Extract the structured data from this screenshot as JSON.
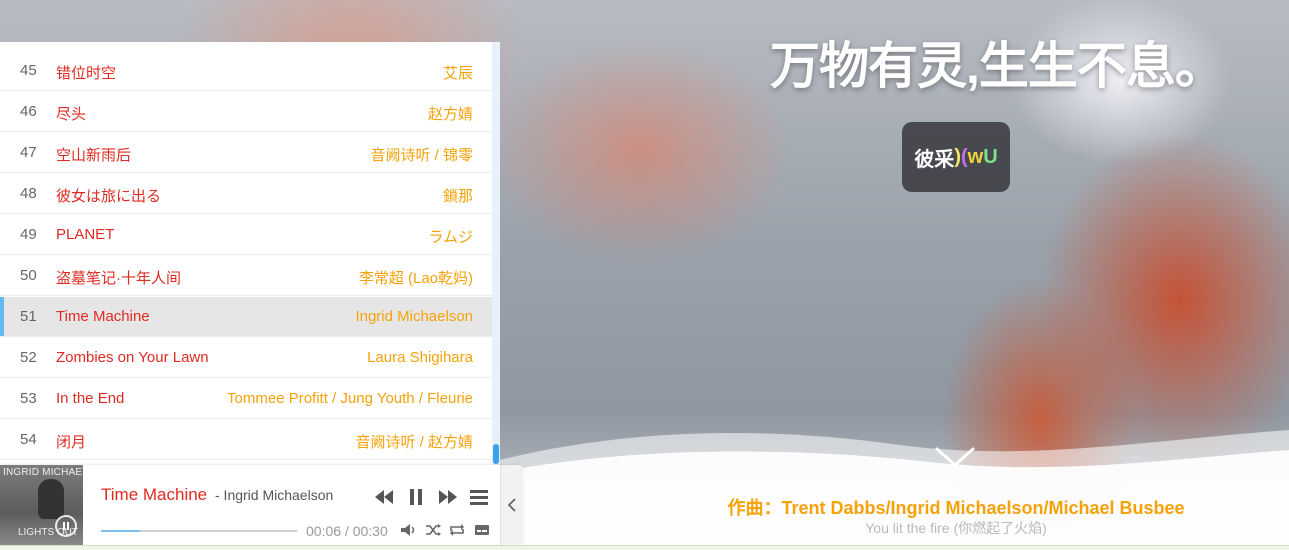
{
  "headline": "万物有灵,生生不息。",
  "badge": {
    "part0": "彼采",
    "part1": ")",
    "part2": "(",
    "part3": "w",
    "part4": "U"
  },
  "lyrics": {
    "credit": "作曲：Trent Dabbs/Ingrid Michaelson/Michael Busbee",
    "line": "You lit the fire (你燃起了火焰)"
  },
  "playlist": {
    "rows": [
      {
        "num": "45",
        "title": "错位时空",
        "artist": "艾辰"
      },
      {
        "num": "46",
        "title": "尽头",
        "artist": "赵方婧"
      },
      {
        "num": "47",
        "title": "空山新雨后",
        "artist": "音阙诗听 / 锦零"
      },
      {
        "num": "48",
        "title": "彼女は旅に出る",
        "artist": "鎖那"
      },
      {
        "num": "49",
        "title": "PLANET",
        "artist": "ラムジ"
      },
      {
        "num": "50",
        "title": "盗墓笔记·十年人间",
        "artist": "李常超 (Lao乾妈)"
      },
      {
        "num": "51",
        "title": "Time Machine",
        "artist": "Ingrid Michaelson"
      },
      {
        "num": "52",
        "title": "Zombies on Your Lawn",
        "artist": "Laura Shigihara"
      },
      {
        "num": "53",
        "title": "In the End",
        "artist": "Tommee Profitt / Jung Youth / Fleurie"
      },
      {
        "num": "54",
        "title": "闭月",
        "artist": "音阙诗听 / 赵方婧"
      }
    ],
    "active_index": 6
  },
  "player": {
    "cover_top_text": "INGRID MICHAELSON",
    "cover_bottom_text": "LIGHTS OUT",
    "title": "Time Machine",
    "artist": " - Ingrid Michaelson",
    "time": "00:06 / 00:30",
    "progress": 0.2
  },
  "colors": {
    "title_red": "#e02b24",
    "artist_orange": "#f5a20a",
    "accent_blue": "#66b8f2"
  },
  "icons": [
    "prev-icon",
    "pause-icon",
    "next-icon",
    "menu-icon",
    "volume-icon",
    "shuffle-icon",
    "repeat-icon",
    "lyrics-icon",
    "chevron-left-icon",
    "chevron-down-icon",
    "play-icon"
  ]
}
